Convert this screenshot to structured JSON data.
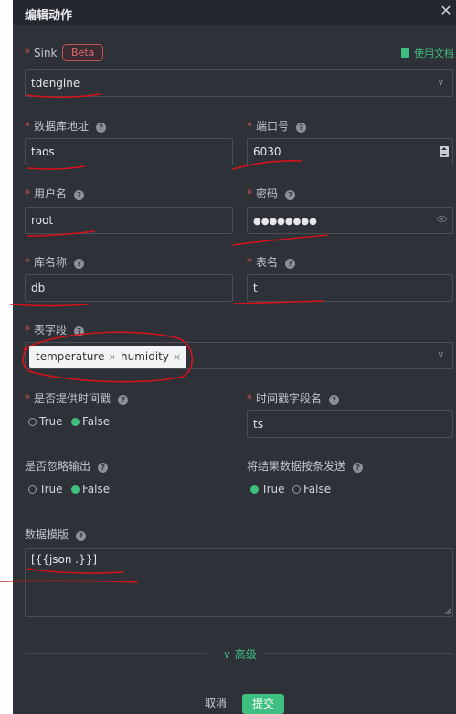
{
  "header": {
    "title": "编辑动作"
  },
  "sink": {
    "label": "Sink",
    "badge": "Beta",
    "doc_link": "使用文档",
    "value": "tdengine"
  },
  "fields": {
    "db_address": {
      "label": "数据库地址",
      "value": "taos"
    },
    "port": {
      "label": "端口号",
      "value": "6030"
    },
    "username": {
      "label": "用户名",
      "value": "root"
    },
    "password": {
      "label": "密码",
      "value": "●●●●●●●●"
    },
    "db_name": {
      "label": "库名称",
      "value": "db"
    },
    "table_name": {
      "label": "表名",
      "value": "t"
    },
    "table_fields": {
      "label": "表字段",
      "tags": [
        "temperature",
        "humidity"
      ]
    },
    "provide_timestamp": {
      "label": "是否提供时间戳",
      "options": [
        "True",
        "False"
      ],
      "selected": "False"
    },
    "timestamp_field": {
      "label": "时间戳字段名",
      "value": "ts"
    },
    "omit_if_empty": {
      "label": "是否忽略输出",
      "options": [
        "True",
        "False"
      ],
      "selected": "False"
    },
    "send_single": {
      "label": "将结果数据按条发送",
      "options": [
        "True",
        "False"
      ],
      "selected": "True"
    },
    "data_template": {
      "label": "数据模版",
      "value": "[{{json .}}]"
    }
  },
  "advanced": {
    "label": "高级"
  },
  "footer": {
    "cancel": "取消",
    "submit": "提交"
  },
  "colors": {
    "accent": "#3fbf7f",
    "required": "#e05a5a",
    "annotation": "#d4141a",
    "panel": "#2e3138"
  }
}
